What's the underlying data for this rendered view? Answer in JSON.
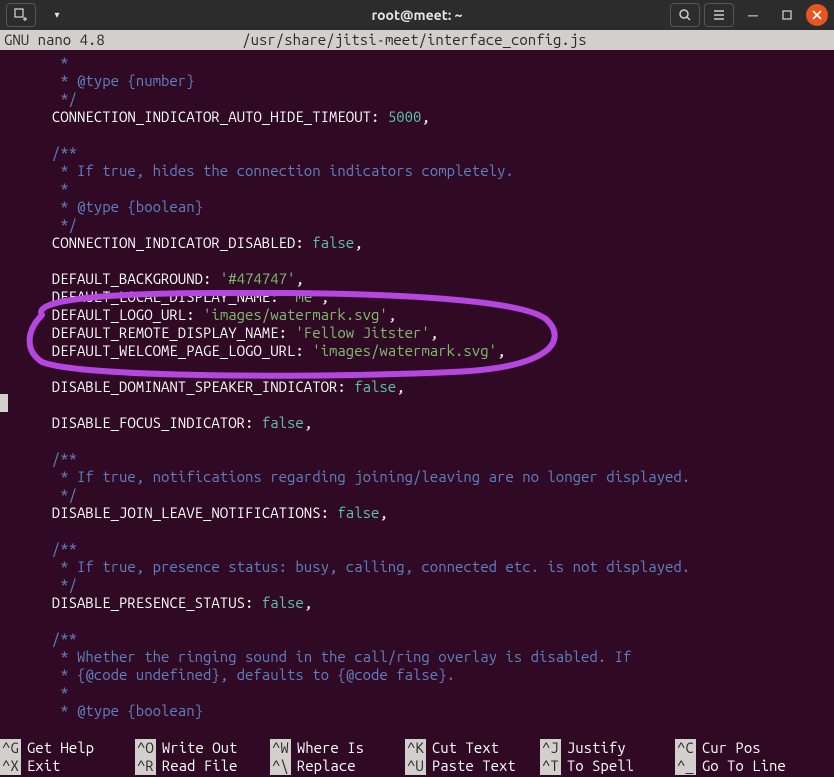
{
  "titlebar": {
    "title": "root@meet: ~"
  },
  "nano": {
    "editor_name": "GNU nano 4.8",
    "filepath": "/usr/share/jitsi-meet/interface_config.js"
  },
  "code": {
    "l1": "   *",
    "l2a": "   * @type ",
    "l2b": "{number}",
    "l3": "   */",
    "l4a": "  CONNECTION_INDICATOR_AUTO_HIDE_TIMEOUT: ",
    "l4b": "5000",
    "l4c": ",",
    "l5": "",
    "l6": "  /**",
    "l7": "   * If true, hides the connection indicators completely.",
    "l8": "   *",
    "l9a": "   * @type ",
    "l9b": "{boolean}",
    "l10": "   */",
    "l11a": "  CONNECTION_INDICATOR_DISABLED: ",
    "l11b": "false",
    "l11c": ",",
    "l12": "",
    "l13a": "  DEFAULT_BACKGROUND: ",
    "l13b": "'#474747'",
    "l13c": ",",
    "l14a": "  DEFAULT_LOCAL_DISPLAY_NAME: ",
    "l14b": "'me'",
    "l14c": ",",
    "l15a": "  DEFAULT_LOGO_URL: ",
    "l15b": "'images/watermark.svg'",
    "l15c": ",",
    "l16a": "  DEFAULT_REMOTE_DISPLAY_NAME: ",
    "l16b": "'Fellow Jitster'",
    "l16c": ",",
    "l17a": "  DEFAULT_WELCOME_PAGE_LOGO_URL: ",
    "l17b": "'images/watermark.svg'",
    "l17c": ",",
    "l18": "",
    "l19a": "  DISABLE_DOMINANT_SPEAKER_INDICATOR: ",
    "l19b": "false",
    "l19c": ",",
    "l20": "",
    "l21a": "  DISABLE_FOCUS_INDICATOR: ",
    "l21b": "false",
    "l21c": ",",
    "l22": "",
    "l23": "  /**",
    "l24": "   * If true, notifications regarding joining/leaving are no longer displayed.",
    "l25": "   */",
    "l26a": "  DISABLE_JOIN_LEAVE_NOTIFICATIONS: ",
    "l26b": "false",
    "l26c": ",",
    "l27": "",
    "l28": "  /**",
    "l29": "   * If true, presence status: busy, calling, connected etc. is not displayed.",
    "l30": "   */",
    "l31a": "  DISABLE_PRESENCE_STATUS: ",
    "l31b": "false",
    "l31c": ",",
    "l32": "",
    "l33": "  /**",
    "l34": "   * Whether the ringing sound in the call/ring overlay is disabled. If",
    "l35": "   * {@code undefined}, defaults to {@code false}.",
    "l36": "   *",
    "l37a": "   * @type ",
    "l37b": "{boolean}"
  },
  "shortcuts": {
    "r1": [
      {
        "k": "^G",
        "t": "Get Help"
      },
      {
        "k": "^O",
        "t": "Write Out"
      },
      {
        "k": "^W",
        "t": "Where Is"
      },
      {
        "k": "^K",
        "t": "Cut Text"
      },
      {
        "k": "^J",
        "t": "Justify"
      },
      {
        "k": "^C",
        "t": "Cur Pos"
      }
    ],
    "r2": [
      {
        "k": "^X",
        "t": "Exit"
      },
      {
        "k": "^R",
        "t": "Read File"
      },
      {
        "k": "^\\",
        "t": "Replace"
      },
      {
        "k": "^U",
        "t": "Paste Text"
      },
      {
        "k": "^T",
        "t": "To Spell"
      },
      {
        "k": "^_",
        "t": "Go To Line"
      }
    ]
  }
}
